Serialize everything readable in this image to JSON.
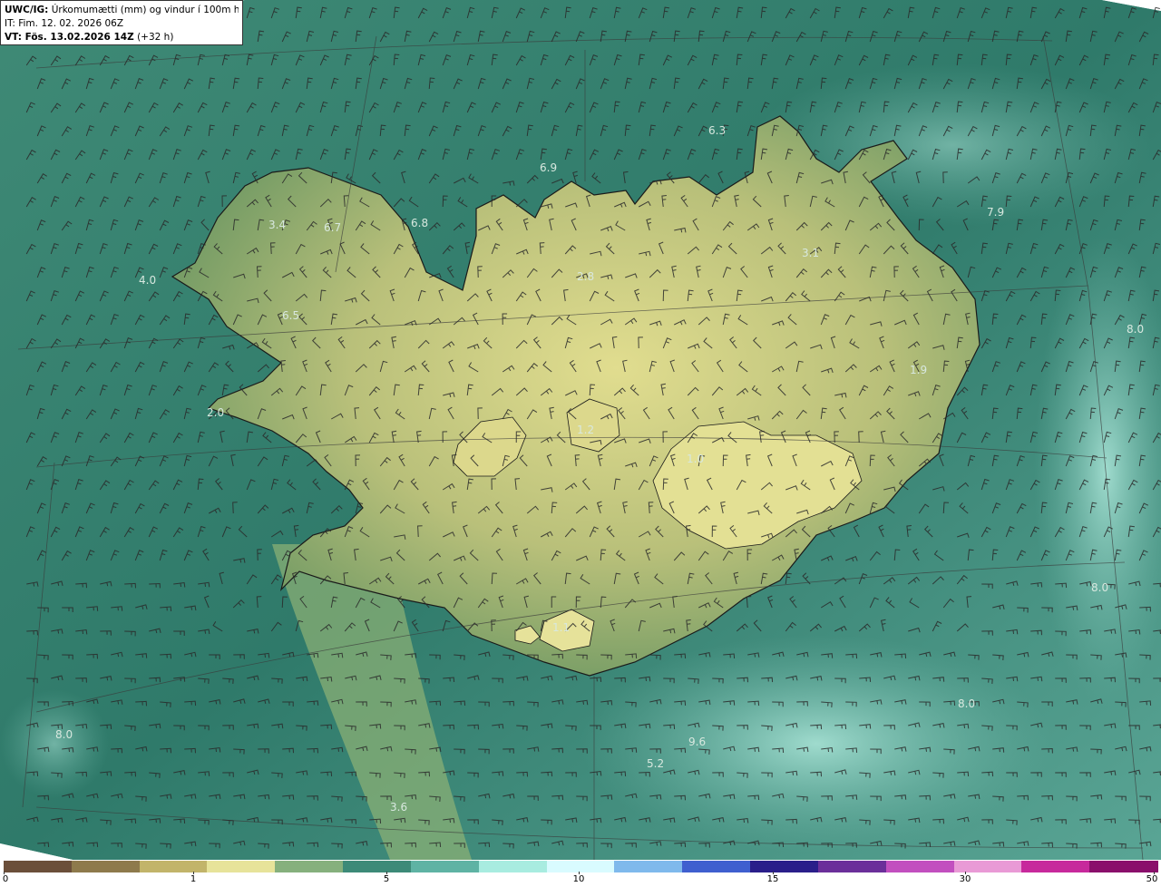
{
  "header": {
    "model": "UWC/IG:",
    "title": "Úrkomumætti (mm) og vindur í 100m hæð",
    "issue_time": "IT: Fim. 12. 02. 2026 06Z",
    "valid_prefix": "VT: Fös. 13.02.2026 14Z",
    "valid_offset": "(+32 h)"
  },
  "map_labels": [
    {
      "text": "6.3"
    },
    {
      "text": "6.9"
    },
    {
      "text": "7.9"
    },
    {
      "text": "3.4"
    },
    {
      "text": "6.7"
    },
    {
      "text": "6.8"
    },
    {
      "text": "4.0"
    },
    {
      "text": "6.5"
    },
    {
      "text": "3.1"
    },
    {
      "text": "2.8"
    },
    {
      "text": "8.0"
    },
    {
      "text": "1.9"
    },
    {
      "text": "1.2"
    },
    {
      "text": "2.0"
    },
    {
      "text": "1.0"
    },
    {
      "text": "8.0"
    },
    {
      "text": "8.0"
    },
    {
      "text": "9.6"
    },
    {
      "text": "5.2"
    },
    {
      "text": "8.0"
    },
    {
      "text": "3.6"
    },
    {
      "text": "1.1"
    }
  ],
  "colorbar": {
    "ticks": [
      "0",
      "1",
      "5",
      "10",
      "15",
      "30",
      "50"
    ],
    "colors": [
      "#6b4f3a",
      "#8e7a4c",
      "#c2b46a",
      "#e7e39a",
      "#86b07d",
      "#3d8a78",
      "#5fb3a4",
      "#a8ece0",
      "#d9fbff",
      "#7fb9ec",
      "#3f5fcf",
      "#2a1e8a",
      "#6b2f9a",
      "#c24fbf",
      "#e99ad6",
      "#c7299c",
      "#8a0f6b"
    ]
  },
  "colors": {
    "sea": "#3e8472",
    "land_low": "#6f9a64",
    "land_high": "#dcd98c",
    "coast": "#1a1a1a",
    "barb": "#2a2a2a"
  }
}
